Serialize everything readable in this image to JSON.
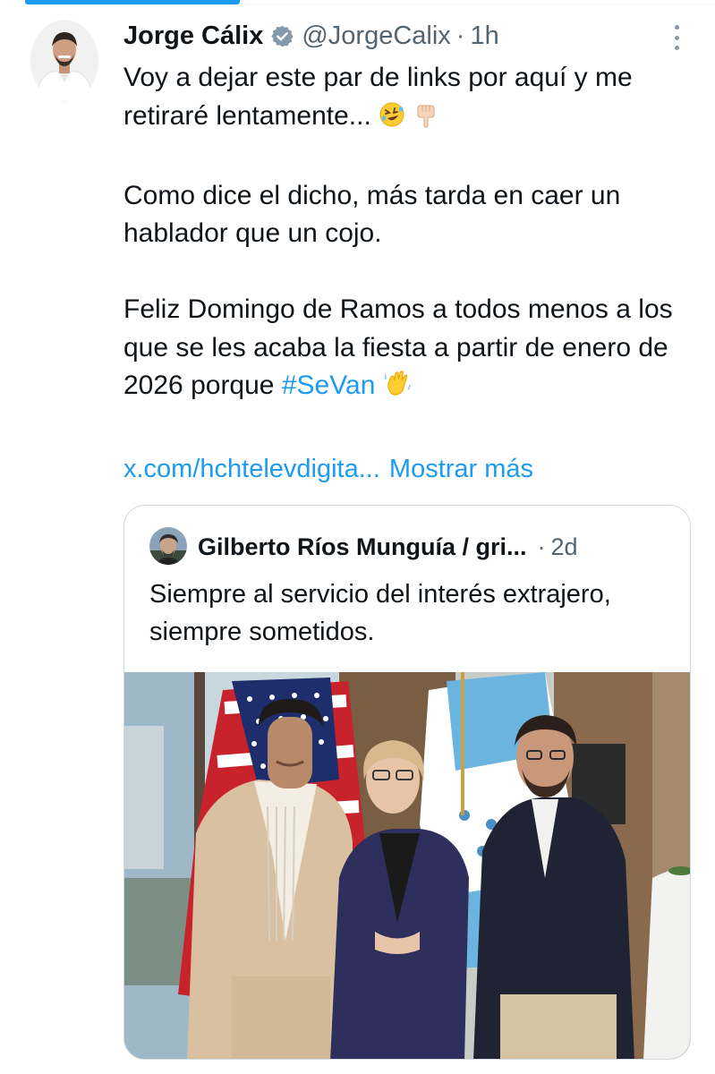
{
  "tweet": {
    "author_name": "Jorge Cálix",
    "handle": "@JorgeCalix",
    "separator": "·",
    "time": "1h",
    "paragraphs": [
      "Voy a dejar este par de links por aquí y me retiraré lentamente...",
      "Como dice el dicho, más tarda en caer un hablador que un cojo.",
      "Feliz Domingo de Ramos a todos menos a los que se les acaba la fiesta a partir de enero de 2026 porque"
    ],
    "emojis": [
      "rolling-on-floor-laughing",
      "backhand-index-pointing-down",
      "waving-hand"
    ],
    "hashtag": "#SeVan",
    "link_text": "x.com/hchtelevdigita...",
    "show_more": "Mostrar más"
  },
  "quote": {
    "author_name": "Gilberto Ríos Munguía / gri...",
    "separator": "·",
    "time": "2d",
    "text": "Siempre al servicio del interés extrajero, siempre sometidos."
  },
  "colors": {
    "accent": "#1d9bf0",
    "text": "#0f1419",
    "secondary": "#536471",
    "border": "#cfd9de"
  }
}
